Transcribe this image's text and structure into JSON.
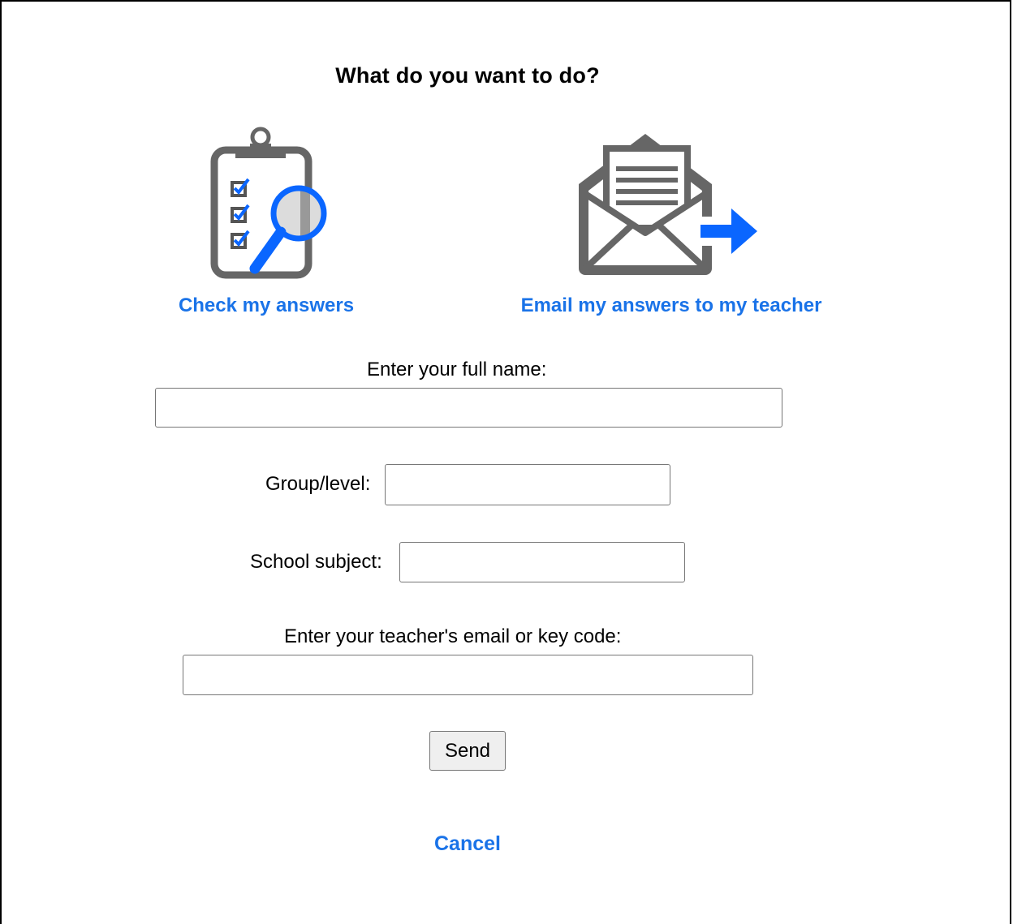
{
  "dialog": {
    "title": "What do you want to do?"
  },
  "options": {
    "check": {
      "label": "Check my answers",
      "icon": "clipboard-magnifier-icon"
    },
    "email": {
      "label": "Email my answers to my teacher",
      "icon": "envelope-arrow-icon"
    }
  },
  "form": {
    "full_name": {
      "label": "Enter your full name:",
      "value": ""
    },
    "group_level": {
      "label": "Group/level:",
      "value": ""
    },
    "school_subject": {
      "label": "School subject:",
      "value": ""
    },
    "teacher_email": {
      "label": "Enter your teacher's email or key code:",
      "value": ""
    },
    "send_label": "Send",
    "cancel_label": "Cancel"
  },
  "colors": {
    "accent": "#1a73e8",
    "icon_gray": "#666666",
    "icon_blue": "#0a66ff"
  }
}
